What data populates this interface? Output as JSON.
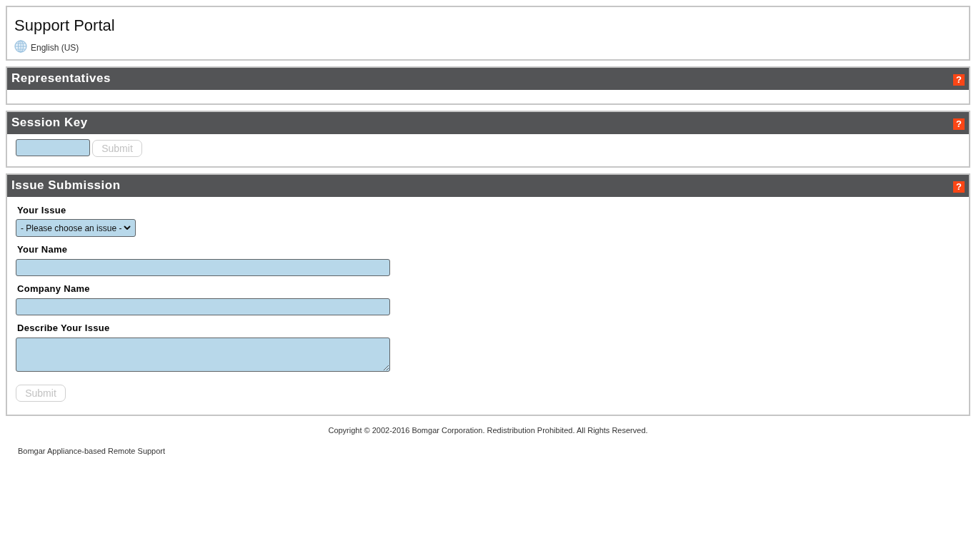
{
  "header": {
    "title": "Support Portal",
    "language": "English (US)"
  },
  "sections": [
    {
      "kind": "empty",
      "title": "Representatives",
      "help": "?"
    },
    {
      "kind": "session_key",
      "title": "Session Key",
      "help": "?",
      "submit": {
        "label": "Submit",
        "disabled": true
      }
    },
    {
      "kind": "form",
      "title": "Issue Submission",
      "help": "?",
      "fields": [
        {
          "kind": "select",
          "label": "Your Issue",
          "value": "- Please choose an issue -"
        },
        {
          "kind": "text",
          "label": "Your Name"
        },
        {
          "kind": "text",
          "label": "Company Name"
        },
        {
          "kind": "textarea",
          "label": "Describe Your Issue"
        }
      ],
      "submit": {
        "label": "Submit",
        "disabled": true
      }
    }
  ],
  "footer": {
    "copyright": "Copyright © 2002-2016 Bomgar Corporation. Redistribution Prohibited. All Rights Reserved.",
    "product": "Bomgar Appliance-based Remote Support"
  }
}
